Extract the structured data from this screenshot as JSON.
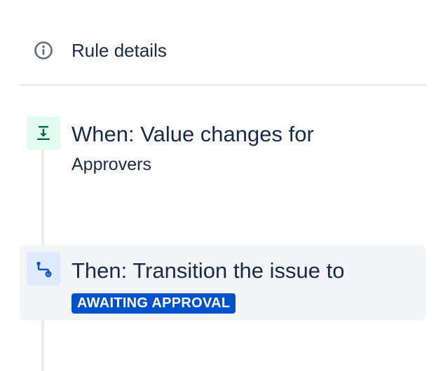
{
  "rule_details": {
    "icon": "info-icon",
    "label": "Rule details"
  },
  "trigger": {
    "icon": "download-arrow-icon",
    "title": "When: Value changes for",
    "subtitle": "Approvers",
    "colors": {
      "icon_bg": "#e3fcef",
      "icon_fg": "#006644"
    }
  },
  "action": {
    "icon": "branch-path-icon",
    "title": "Then: Transition the issue to",
    "status_lozenge": "AWAITING APPROVAL",
    "colors": {
      "icon_bg": "#deebff",
      "icon_fg": "#0052cc",
      "lozenge_bg": "#0052cc",
      "row_bg": "#f4f5f7"
    }
  }
}
